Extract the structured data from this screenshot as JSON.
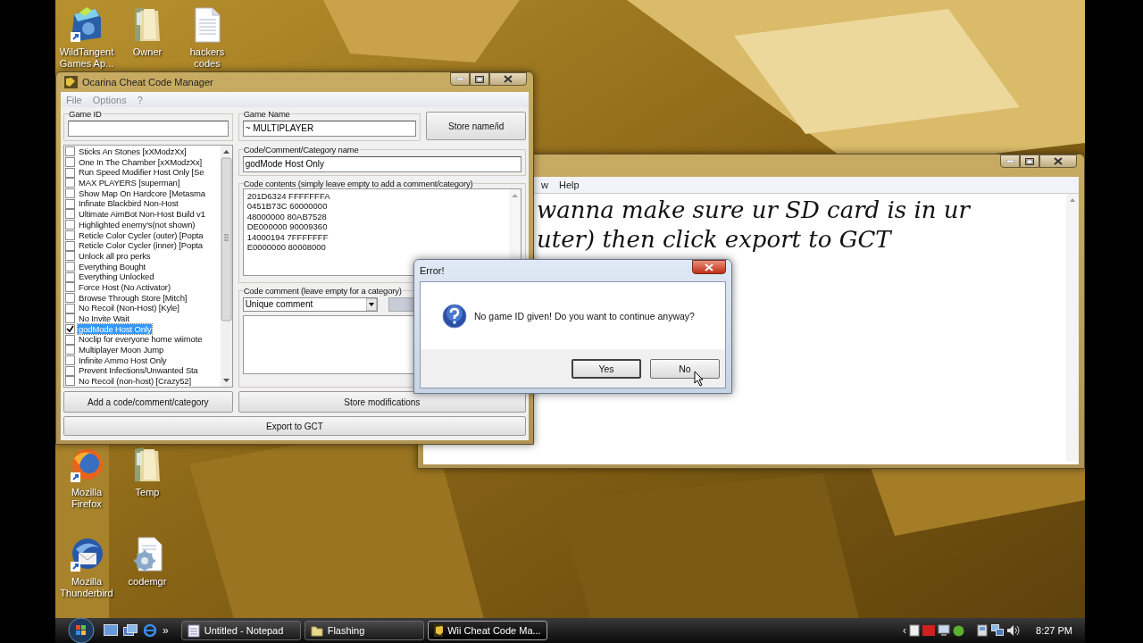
{
  "desktop_icons": [
    {
      "kind": "installer",
      "lines": [
        "WildTangent",
        "Games Ap..."
      ]
    },
    {
      "kind": "folder",
      "lines": [
        "Owner"
      ]
    },
    {
      "kind": "document",
      "lines": [
        "hackers",
        "codes"
      ]
    },
    {
      "kind": "firefox",
      "lines": [
        "Mozilla",
        "Firefox"
      ]
    },
    {
      "kind": "folder",
      "lines": [
        "Temp"
      ]
    },
    {
      "kind": "thunderbird",
      "lines": [
        "Mozilla",
        "Thunderbird"
      ]
    },
    {
      "kind": "gear-document",
      "lines": [
        "codemgr"
      ]
    }
  ],
  "notepad": {
    "menu": [
      "w",
      "Help"
    ],
    "lines": [
      "wanna make sure ur SD card is in ur",
      "uter) then click export to GCT"
    ]
  },
  "cheat_manager": {
    "title": "Ocarina Cheat Code Manager",
    "menu": [
      "File",
      "Options",
      "?"
    ],
    "game_id": {
      "label": "Game ID"
    },
    "game_name": {
      "label": "Game Name",
      "value": "~ MULTIPLAYER"
    },
    "store_name_button": "Store name/id",
    "codes": [
      {
        "label": "Sticks An Stones [xXModzXx]",
        "checked": false,
        "selected": false
      },
      {
        "label": "One In The Chamber [xXModzXx]",
        "checked": false,
        "selected": false
      },
      {
        "label": "Run Speed Modifier Host Only [Se",
        "checked": false,
        "selected": false
      },
      {
        "label": "MAX PLAYERS [superman]",
        "checked": false,
        "selected": false
      },
      {
        "label": "Show Map On Hardcore [Metasma",
        "checked": false,
        "selected": false
      },
      {
        "label": "Infinate Blackbird Non-Host",
        "checked": false,
        "selected": false
      },
      {
        "label": "Ultimate AimBot Non-Host Build v1",
        "checked": false,
        "selected": false
      },
      {
        "label": "Highlighted enemy's(not shown)",
        "checked": false,
        "selected": false
      },
      {
        "label": "Reticle Color Cycler (outer) [Popta",
        "checked": false,
        "selected": false
      },
      {
        "label": "Reticle Color Cycler (inner) [Popta",
        "checked": false,
        "selected": false
      },
      {
        "label": "Unlock all pro perks",
        "checked": false,
        "selected": false
      },
      {
        "label": "Everything Bought",
        "checked": false,
        "selected": false
      },
      {
        "label": "Everything Unlocked",
        "checked": false,
        "selected": false
      },
      {
        "label": "Force Host (No Activator)",
        "checked": false,
        "selected": false
      },
      {
        "label": "Browse Through Store [Mitch]",
        "checked": false,
        "selected": false
      },
      {
        "label": "No Recoil (Non-Host) [Kyle]",
        "checked": false,
        "selected": false
      },
      {
        "label": "No Invite Wait",
        "checked": false,
        "selected": false
      },
      {
        "label": "godMode Host Only",
        "checked": true,
        "selected": true
      },
      {
        "label": "Noclip for everyone home wiimote",
        "checked": false,
        "selected": false
      },
      {
        "label": "Multiplayer Moon Jump",
        "checked": false,
        "selected": false
      },
      {
        "label": "Infinite Ammo Host Only",
        "checked": false,
        "selected": false
      },
      {
        "label": "Prevent Infections/Unwanted Sta",
        "checked": false,
        "selected": false
      },
      {
        "label": "No Recoil (non-host) [Crazy52]",
        "checked": false,
        "selected": false
      }
    ],
    "name_field": {
      "label": "Code/Comment/Category name",
      "value": "godMode Host Only"
    },
    "code_contents": {
      "label": "Code contents (simply leave empty to add a comment/category)",
      "lines": [
        "201D6324 FFFFFFFA",
        "0451B73C 60000000",
        "48000000 80AB7528",
        "DE000000 90009360",
        "14000194 7FFFFFFF",
        "E0000000 80008000"
      ]
    },
    "comment": {
      "label": "Code comment (leave empty for a category)",
      "dropdown": "Unique comment"
    },
    "add_button": "Add a code/comment/category",
    "store_button": "Store modifications",
    "export_button": "Export to GCT"
  },
  "dialog": {
    "title": "Error!",
    "message": "No game ID given! Do you want to continue anyway?",
    "buttons": [
      "Yes",
      "No"
    ]
  },
  "taskbar": {
    "more": "»",
    "tasks": [
      {
        "label": "Untitled - Notepad",
        "kind": "notepad",
        "selected": false
      },
      {
        "label": "Flashing",
        "kind": "folder",
        "selected": false
      },
      {
        "label": "Wii Cheat Code Ma...",
        "kind": "ocarina",
        "selected": true
      }
    ],
    "tray_more": "‹",
    "clock": "8:27 PM"
  }
}
